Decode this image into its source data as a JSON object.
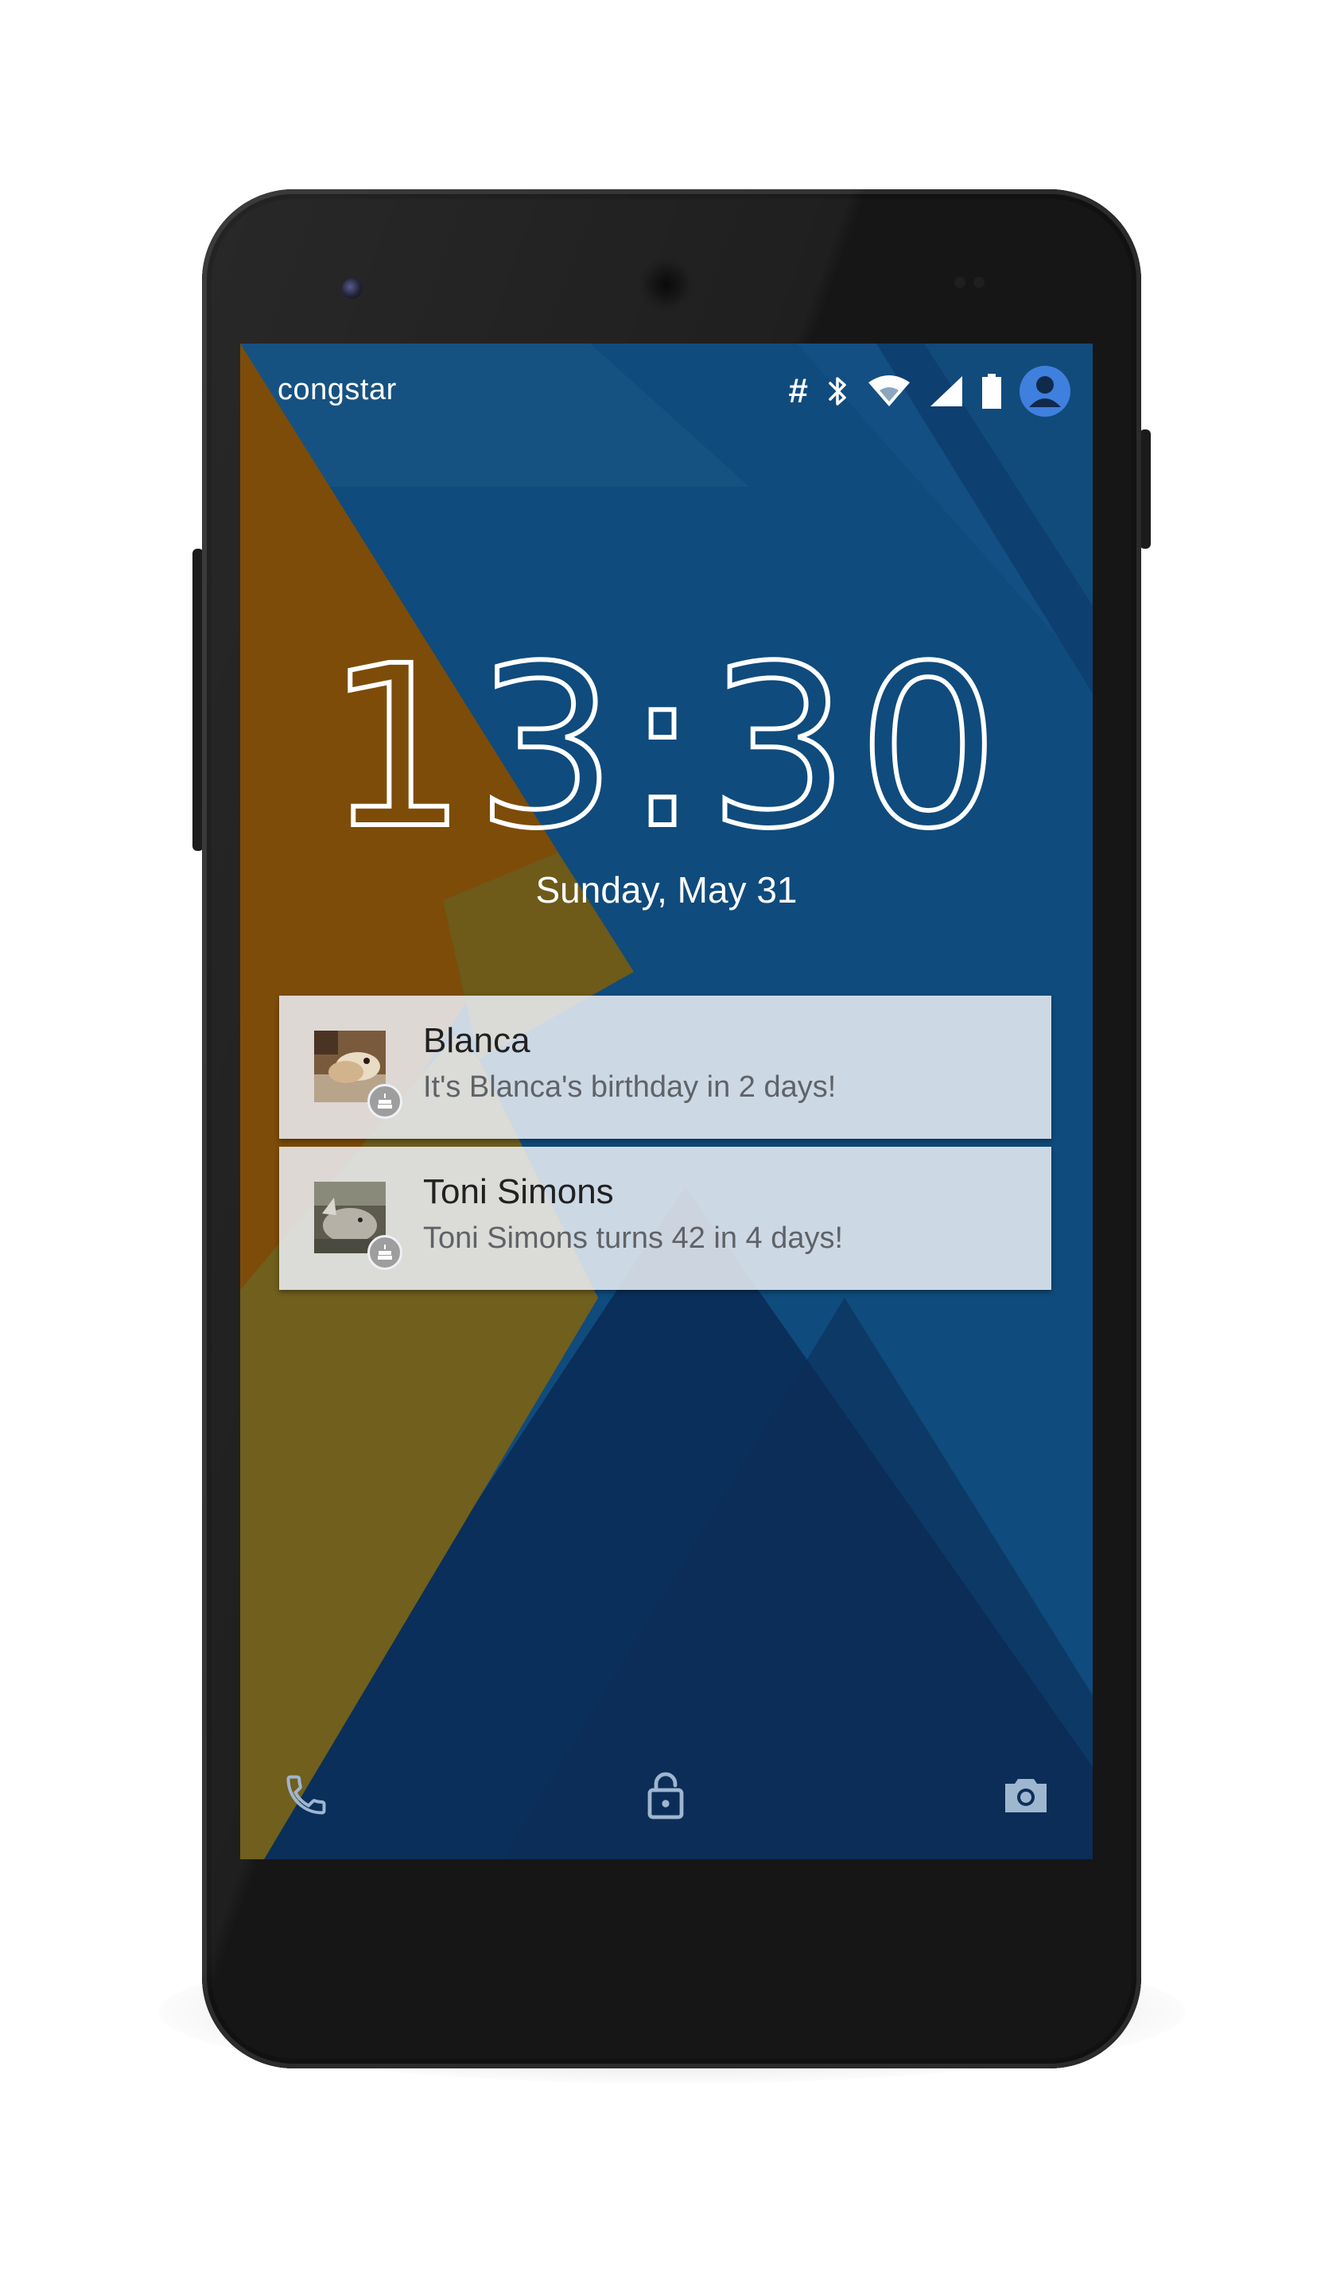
{
  "status_bar": {
    "carrier": "congstar",
    "icons": [
      "hash-icon",
      "bluetooth-icon",
      "wifi-icon",
      "cell-signal-icon",
      "battery-icon",
      "user-avatar-icon"
    ],
    "hash_glyph": "#"
  },
  "lockscreen": {
    "time": "13:30",
    "date": "Sunday, May 31"
  },
  "notifications": [
    {
      "title": "Blanca",
      "text": "It's Blanca's birthday in 2 days!",
      "icon": "birthday-cake-icon"
    },
    {
      "title": "Toni Simons",
      "text": "Toni Simons turns 42 in 4 days!",
      "icon": "birthday-cake-icon"
    }
  ],
  "bottom_actions": [
    "phone-icon",
    "lock-icon",
    "camera-icon"
  ],
  "colors": {
    "wallpaper_blue": "#0f4b7d",
    "wallpaper_dark_blue": "#0b2f5c",
    "wallpaper_brown": "#7a4a07",
    "wallpaper_olive": "#6e5e1e",
    "accent_avatar": "#3f7fde"
  }
}
